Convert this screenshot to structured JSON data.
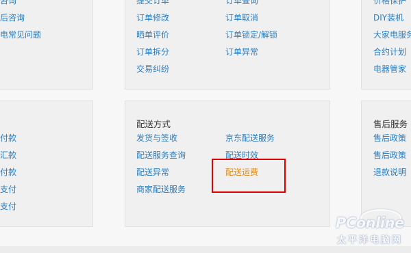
{
  "top_row": {
    "left_col": [
      "物流咨询",
      "售后咨询",
      "家电常见问题"
    ],
    "middle_col": [
      "提交订单",
      "订单修改",
      "晒单评价",
      "订单拆分",
      "交易纠纷"
    ],
    "right_col": [
      "订单查询",
      "订单取消",
      "订单锁定/解锁",
      "订单异常"
    ],
    "far_right_col": [
      "价格保护",
      "DIY装机",
      "大家电服务",
      "合约计划",
      "电器管家"
    ]
  },
  "bottom_row": {
    "left_col": [
      "货到付款",
      "邮局汇款",
      "分期付款",
      "发票支付",
      "钱包支付"
    ],
    "middle": {
      "heading": "配送方式",
      "col1": [
        "发货与签收",
        "配送服务查询",
        "配送异常",
        "商家配送服务"
      ],
      "col2": [
        "京东配送服务",
        "配送时效",
        "配送运费"
      ]
    },
    "right": {
      "heading": "售后服务",
      "items": [
        "售后政策",
        "售后政策",
        "退款说明"
      ]
    }
  },
  "watermark": {
    "main": "PConline",
    "sub": "太平洋电脑网"
  },
  "colors": {
    "link": "#2a7dbf",
    "active_link": "#e08a1a",
    "highlight": "#e00000"
  }
}
